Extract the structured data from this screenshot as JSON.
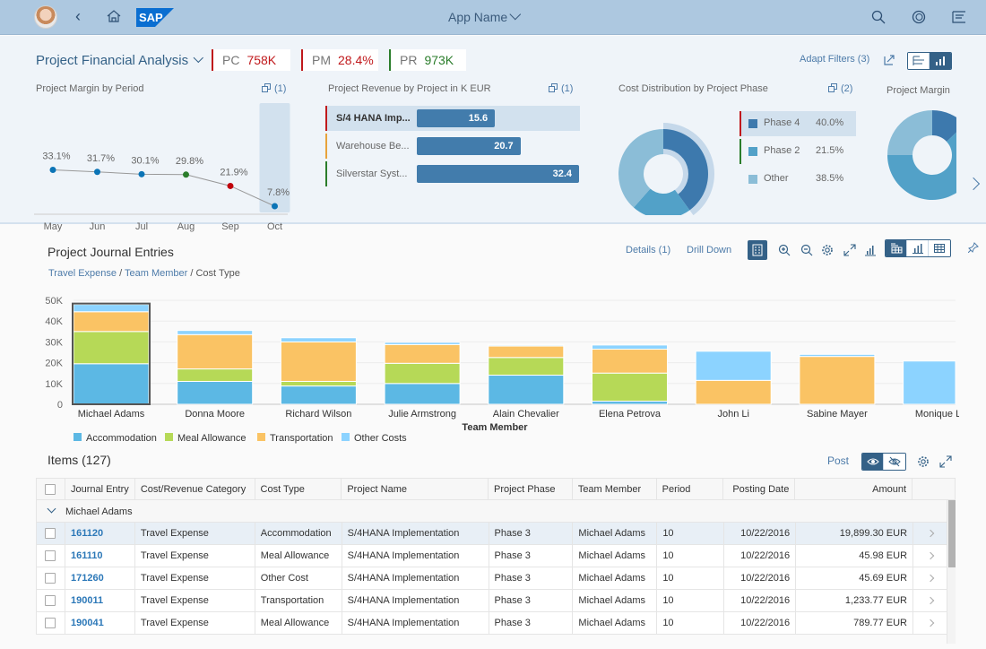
{
  "shell": {
    "app_title": "App Name",
    "icons": [
      "avatar",
      "back-icon",
      "home-icon",
      "sap-logo",
      "search-icon",
      "copilot-icon",
      "menu-icon"
    ]
  },
  "header": {
    "title": "Project Financial Analysis",
    "kpis": [
      {
        "label": "PC",
        "value": "758K",
        "color": "#c0191c"
      },
      {
        "label": "PM",
        "value": "28.4%",
        "color": "#c0191c"
      },
      {
        "label": "PR",
        "value": "973K",
        "color": "#2b7d2b"
      }
    ],
    "adapt_filters": "Adapt Filters (3)",
    "cards": {
      "margin": {
        "title": "Project Margin by Period",
        "count": "(1)",
        "points": [
          {
            "period": "May",
            "value": 33.1,
            "label": "33.1%",
            "color": "#0b74b6"
          },
          {
            "period": "Jun",
            "value": 31.7,
            "label": "31.7%",
            "color": "#0b74b6"
          },
          {
            "period": "Jul",
            "value": 30.1,
            "label": "30.1%",
            "color": "#0b74b6"
          },
          {
            "period": "Aug",
            "value": 29.8,
            "label": "29.8%",
            "color": "#2b7d2b"
          },
          {
            "period": "Sep",
            "value": 21.9,
            "label": "21.9%",
            "color": "#c0000a"
          },
          {
            "period": "Oct",
            "value": 7.8,
            "label": "7.8%",
            "color": "#0b74b6"
          }
        ],
        "selected": "Oct"
      },
      "revenue": {
        "title": "Project Revenue by Project in K EUR",
        "count": "(1)",
        "rows": [
          {
            "label": "S/4 HANA Imp...",
            "value": 15.6,
            "display": "15.6",
            "edge": "#c0191c",
            "selected": true
          },
          {
            "label": "Warehouse Be...",
            "value": 20.7,
            "display": "20.7",
            "edge": "#e8a33b",
            "selected": false
          },
          {
            "label": "Silverstar Syst...",
            "value": 32.4,
            "display": "32.4",
            "edge": "#2b7d2b",
            "selected": false
          }
        ]
      },
      "cost": {
        "title": "Cost Distribution by Project Phase",
        "count": "(2)",
        "slices": [
          {
            "name": "Phase 4",
            "value": 40.0,
            "label": "40.0%",
            "color": "#3d79ad",
            "edge": "#c0191c",
            "selected": true
          },
          {
            "name": "Phase 2",
            "value": 21.5,
            "label": "21.5%",
            "color": "#52a1c8",
            "edge": "#2b7d2b",
            "selected": false
          },
          {
            "name": "Other",
            "value": 38.5,
            "label": "38.5%",
            "color": "#8bbdd7",
            "edge": "",
            "selected": false
          }
        ]
      },
      "margin2": {
        "title": "Project Margin"
      }
    }
  },
  "journal": {
    "title": "Project Journal Entries",
    "breadcrumb": [
      "Travel Expense",
      "Team Member",
      "Cost Type"
    ],
    "details": "Details (1)",
    "drill_down": "Drill Down",
    "items_title": "Items (127)",
    "post": "Post"
  },
  "chart_data": {
    "type": "bar",
    "stacked": true,
    "title": "",
    "xlabel": "Team Member",
    "ylabel": "",
    "ylim": [
      0,
      50000
    ],
    "yticks": [
      "0",
      "10K",
      "20K",
      "30K",
      "40K",
      "50K"
    ],
    "grid": true,
    "legend": "bottom-left",
    "categories": [
      "Michael Adams",
      "Donna Moore",
      "Richard Wilson",
      "Julie Armstrong",
      "Alain Chevalier",
      "Elena Petrova",
      "John Li",
      "Sabine Mayer",
      "Monique Le"
    ],
    "selected": "Michael Adams",
    "series": [
      {
        "name": "Accommodation",
        "color": "#5cb8e4",
        "values": [
          19500,
          11000,
          8800,
          10000,
          14000,
          1500,
          0,
          0,
          0
        ]
      },
      {
        "name": "Meal Allowance",
        "color": "#b6d957",
        "values": [
          15500,
          6000,
          2200,
          9700,
          8500,
          13500,
          0,
          0,
          0
        ]
      },
      {
        "name": "Transportation",
        "color": "#fac364",
        "values": [
          9500,
          16500,
          19000,
          9000,
          5500,
          11500,
          11500,
          23000,
          0
        ]
      },
      {
        "name": "Other Costs",
        "color": "#8cd3ff",
        "values": [
          3500,
          2000,
          2000,
          1100,
          500,
          2000,
          14000,
          1000,
          20800
        ]
      }
    ]
  },
  "table": {
    "columns": [
      "Journal Entry",
      "Cost/Revenue Category",
      "Cost Type",
      "Project Name",
      "Project Phase",
      "Team Member",
      "Period",
      "Posting Date",
      "Amount"
    ],
    "group": "Michael Adams",
    "rows": [
      {
        "je": "161120",
        "cat": "Travel Expense",
        "type": "Accommodation",
        "proj": "S/4HANA Implementation",
        "phase": "Phase 3",
        "member": "Michael Adams",
        "period": "10",
        "date": "10/22/2016",
        "amount": "19,899.30 EUR",
        "selected": true
      },
      {
        "je": "161110",
        "cat": "Travel Expense",
        "type": "Meal Allowance",
        "proj": "S/4HANA Implementation",
        "phase": "Phase 3",
        "member": "Michael Adams",
        "period": "10",
        "date": "10/22/2016",
        "amount": "45.98 EUR",
        "selected": false
      },
      {
        "je": "171260",
        "cat": "Travel Expense",
        "type": "Other Cost",
        "proj": "S/4HANA Implementation",
        "phase": "Phase 3",
        "member": "Michael Adams",
        "period": "10",
        "date": "10/22/2016",
        "amount": "45.69 EUR",
        "selected": false
      },
      {
        "je": "190011",
        "cat": "Travel Expense",
        "type": "Transportation",
        "proj": "S/4HANA Implementation",
        "phase": "Phase 3",
        "member": "Michael Adams",
        "period": "10",
        "date": "10/22/2016",
        "amount": "1,233.77 EUR",
        "selected": false
      },
      {
        "je": "190041",
        "cat": "Travel Expense",
        "type": "Meal Allowance",
        "proj": "S/4HANA Implementation",
        "phase": "Phase 3",
        "member": "Michael Adams",
        "period": "10",
        "date": "10/22/2016",
        "amount": "789.77 EUR",
        "selected": false
      }
    ]
  }
}
